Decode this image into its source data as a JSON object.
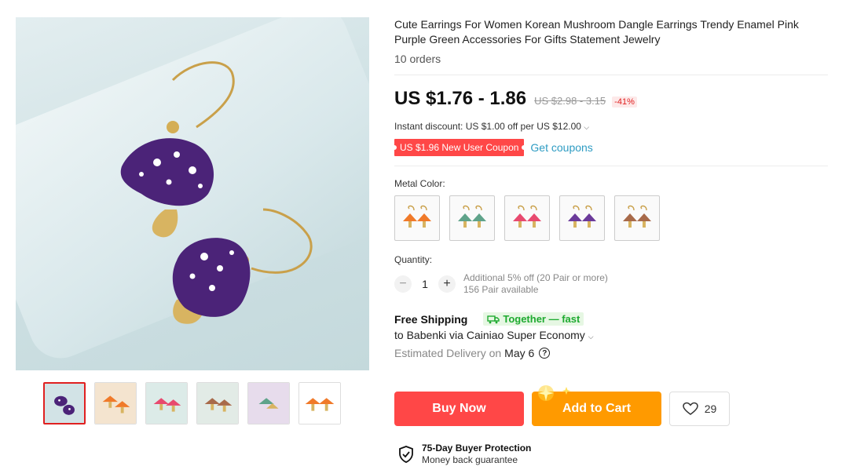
{
  "product": {
    "title": "Cute Earrings For Women Korean Mushroom Dangle Earrings Trendy Enamel Pink Purple Green Accessories For Gifts Statement Jewelry",
    "orders": "10 orders",
    "price": "US $1.76 - 1.86",
    "original_price": "US $2.98 - 3.15",
    "discount": "-41%",
    "instant_discount": "Instant discount: US $1.00 off per US $12.00",
    "coupon_badge": "US $1.96 New User Coupon",
    "get_coupons": "Get coupons"
  },
  "colors": {
    "accent": "#ff4747",
    "cart": "#ff9a00",
    "link": "#2e9cc3",
    "ship_green": "#1eaa30"
  },
  "metal_color": {
    "label": "Metal Color:",
    "options": [
      {
        "name": "orange",
        "color": "#f07a2a"
      },
      {
        "name": "green",
        "color": "#5fa38a"
      },
      {
        "name": "pink",
        "color": "#e84a6f"
      },
      {
        "name": "purple",
        "color": "#6b3a9a"
      },
      {
        "name": "brown",
        "color": "#a86a4a"
      }
    ]
  },
  "quantity": {
    "label": "Quantity:",
    "minus": "−",
    "plus": "+",
    "value": "1",
    "additional": "Additional 5% off (20 Pair or more)",
    "available": "156 Pair available"
  },
  "shipping": {
    "title": "Free Shipping",
    "badge": "Together — fast",
    "to": "to Babenki via Cainiao Super Economy",
    "estimated": "Estimated Delivery on",
    "date": "May 6"
  },
  "actions": {
    "buy_now": "Buy Now",
    "add_to_cart": "Add to Cart",
    "wishlist_count": "29"
  },
  "protection": {
    "title": "75-Day Buyer Protection",
    "subtitle": "Money back guarantee"
  },
  "gallery": {
    "thumbnails": [
      "purple",
      "orange",
      "pink",
      "brown",
      "green",
      "orange-white"
    ]
  }
}
